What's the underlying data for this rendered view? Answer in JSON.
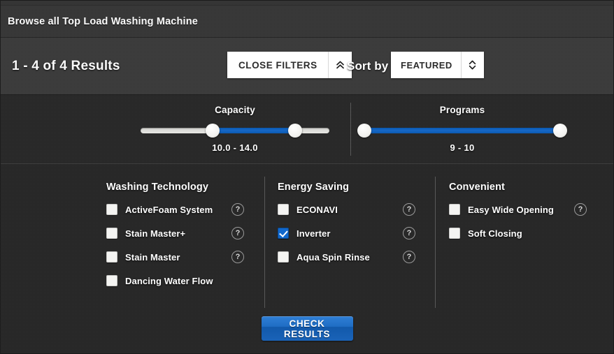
{
  "header": {
    "browse_title": "Browse all Top Load Washing Machine"
  },
  "results_bar": {
    "results_count": "1 - 4 of 4 Results",
    "close_filters_label": "CLOSE FILTERS",
    "close_filters_icon": "double-chevron-up-icon",
    "sort_by_label": "Sort by",
    "sort_value": "FEATURED",
    "sort_icon": "chevron-up-down-icon",
    "sort_options": [
      "FEATURED"
    ]
  },
  "sliders": [
    {
      "name": "capacity",
      "title": "Capacity",
      "value_text": "10.0 - 14.0",
      "min_value": "10.0",
      "max_value": "14.0",
      "left_percent": 38,
      "right_percent": 82
    },
    {
      "name": "programs",
      "title": "Programs",
      "value_text": "9 - 10",
      "min_value": "9",
      "max_value": "10",
      "left_percent": 0,
      "right_percent": 100
    }
  ],
  "filter_columns": [
    {
      "heading": "Washing Technology",
      "items": [
        {
          "label": "ActiveFoam  System",
          "checked": false,
          "help": true
        },
        {
          "label": "Stain Master+",
          "checked": false,
          "help": true
        },
        {
          "label": "Stain Master",
          "checked": false,
          "help": true
        },
        {
          "label": "Dancing Water Flow",
          "checked": false,
          "help": false
        }
      ]
    },
    {
      "heading": "Energy Saving",
      "items": [
        {
          "label": "ECONAVI",
          "checked": false,
          "help": true
        },
        {
          "label": "Inverter",
          "checked": true,
          "help": true
        },
        {
          "label": "Aqua Spin Rinse",
          "checked": false,
          "help": true
        }
      ]
    },
    {
      "heading": "Convenient",
      "items": [
        {
          "label": "Easy Wide Opening",
          "checked": false,
          "help": true
        },
        {
          "label": "Soft Closing",
          "checked": false,
          "help": false
        }
      ]
    }
  ],
  "footer": {
    "check_results_label": "CHECK RESULTS"
  },
  "help_icon_glyph": "?",
  "colors": {
    "accent_blue": "#1168cc",
    "slider_fill": "#1668c8",
    "panel_dark": "#262626",
    "panel_mid": "#3a3a3a",
    "title_bar": "#363636"
  }
}
